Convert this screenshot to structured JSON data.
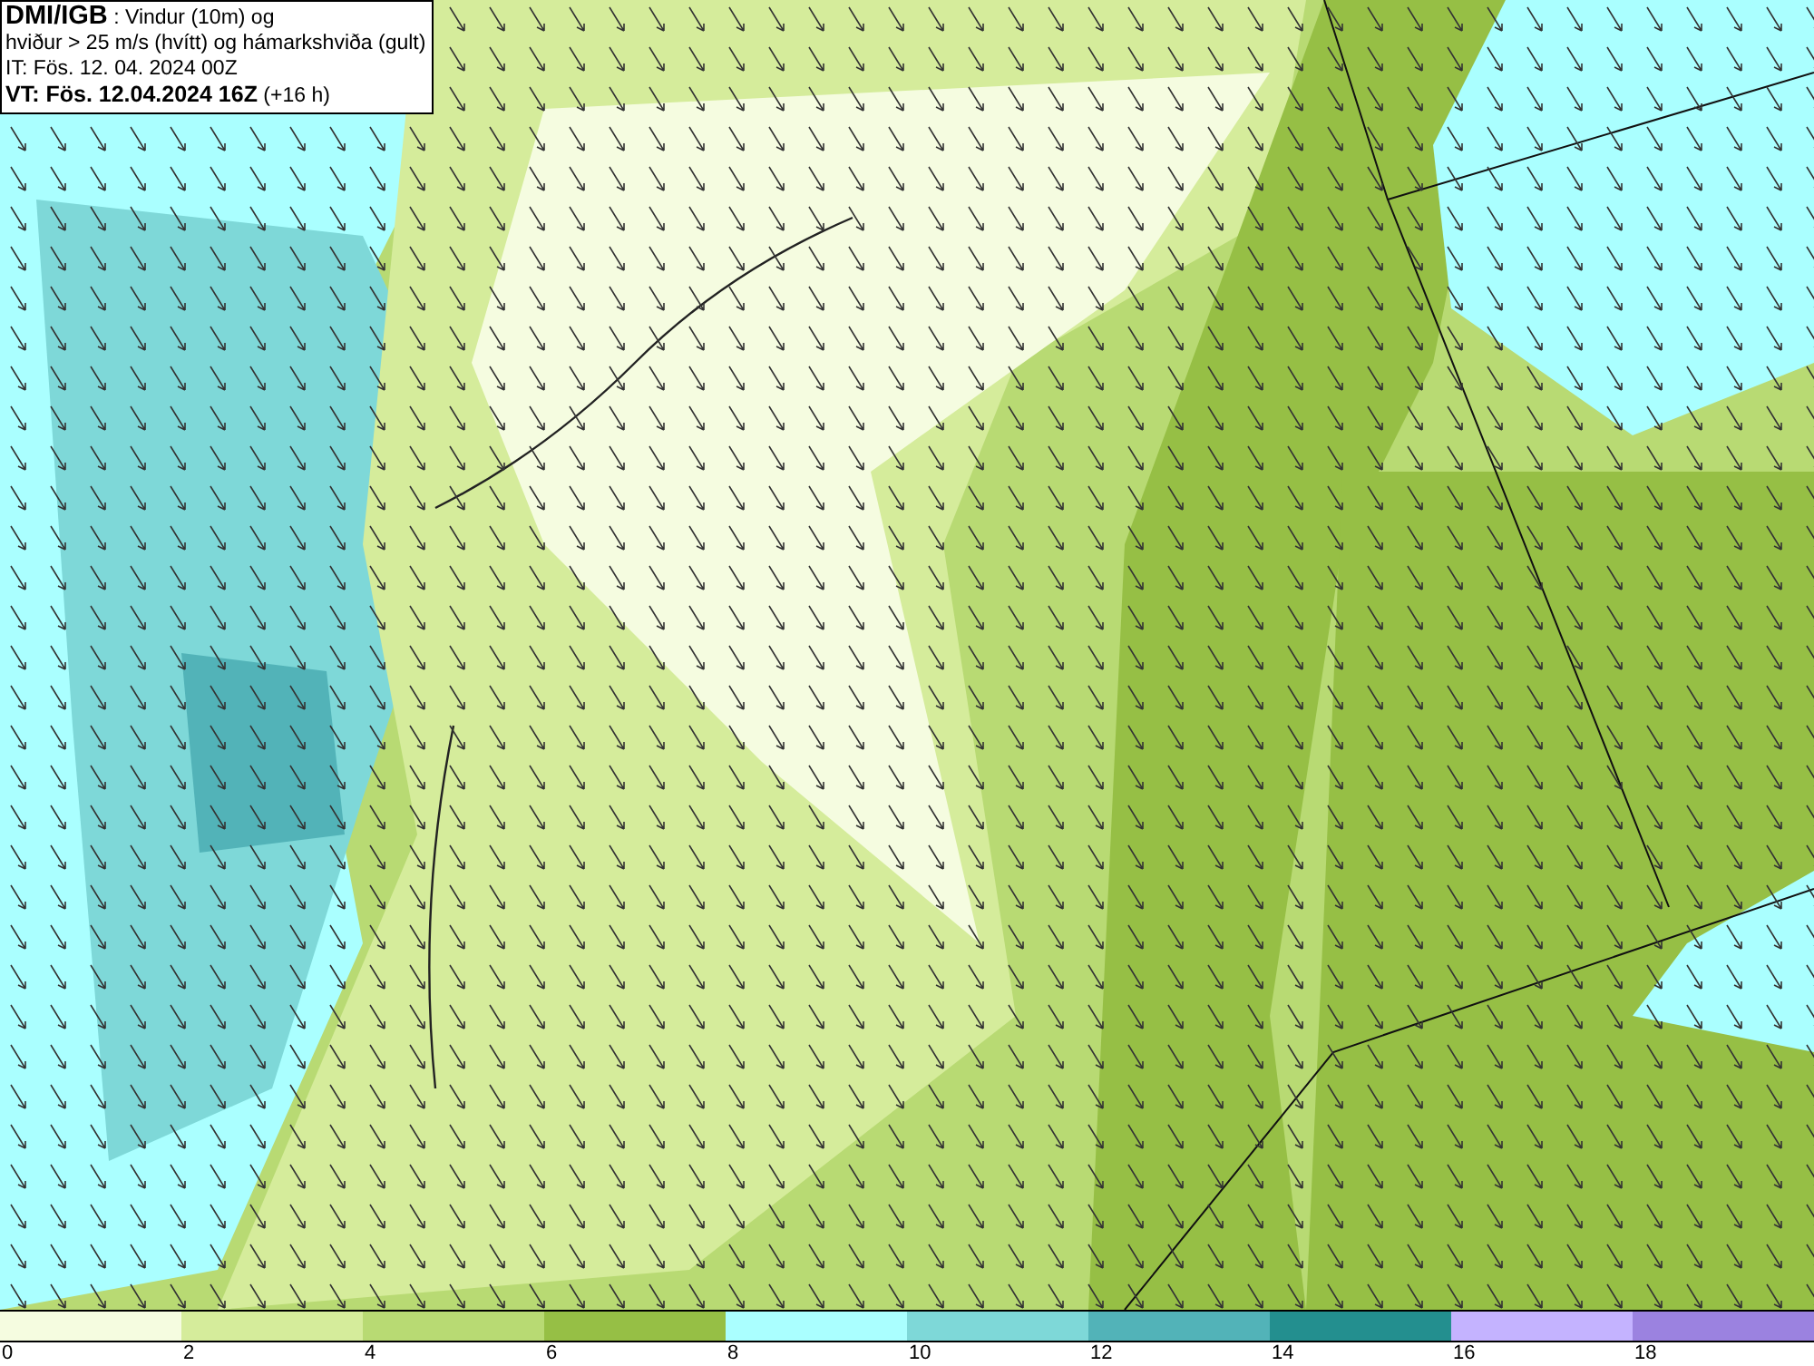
{
  "title_box": {
    "lines": [
      "**DMI/IGB** : Vindur (10m) og",
      "hviður > 25 m/s (hvítt) og hámarkshviða (gult)",
      "IT: Fös. 12. 04. 2024 00Z",
      "**VT: Fös. 12.04.2024 16Z** (+16 h)"
    ]
  },
  "legend": {
    "bins": [
      {
        "color": "#f5fce0"
      },
      {
        "color": "#d5ec9b"
      },
      {
        "color": "#b8da73"
      },
      {
        "color": "#96bf45"
      },
      {
        "color": "#aaffff"
      },
      {
        "color": "#7ed8d8"
      },
      {
        "color": "#52b3b8"
      },
      {
        "color": "#238f8f"
      },
      {
        "color": "#c4b3ff"
      },
      {
        "color": "#9b82e0"
      }
    ],
    "labels": [
      "0",
      "2",
      "4",
      "6",
      "8",
      "10",
      "12",
      "14",
      "16",
      "18"
    ]
  }
}
